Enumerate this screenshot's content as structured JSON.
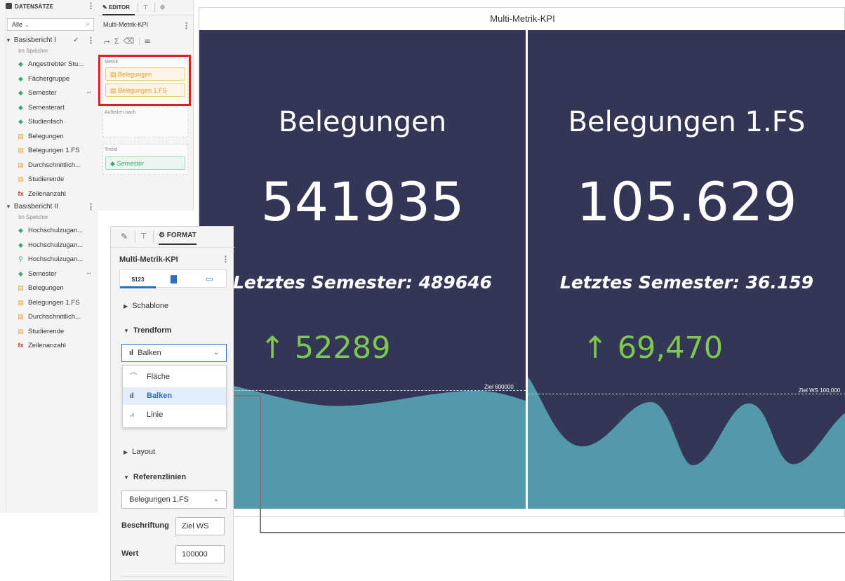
{
  "datasets": {
    "header": "DATENSÄTZE",
    "filter": "Alle",
    "groups": [
      {
        "name": "Basisbericht I",
        "storage": "Im Speicher",
        "items": [
          {
            "label": "Angestrebter Stu...",
            "kind": "dimension"
          },
          {
            "label": "Fächergruppe",
            "kind": "dimension"
          },
          {
            "label": "Semester",
            "kind": "dimension"
          },
          {
            "label": "Semesterart",
            "kind": "dimension"
          },
          {
            "label": "Studienfach",
            "kind": "dimension"
          },
          {
            "label": "Belegungen",
            "kind": "measure"
          },
          {
            "label": "Belegungen 1.FS",
            "kind": "measure"
          },
          {
            "label": "Durchschnittlich...",
            "kind": "measure"
          },
          {
            "label": "Studierende",
            "kind": "measure"
          },
          {
            "label": "Zeilenanzahl",
            "kind": "calc"
          }
        ]
      },
      {
        "name": "Basisbericht II",
        "storage": "Im Speicher",
        "items": [
          {
            "label": "Hochschulzugan...",
            "kind": "dimension"
          },
          {
            "label": "Hochschulzugan...",
            "kind": "dimension"
          },
          {
            "label": "Hochschulzugan...",
            "kind": "location"
          },
          {
            "label": "Semester",
            "kind": "dimension"
          },
          {
            "label": "Belegungen",
            "kind": "measure"
          },
          {
            "label": "Belegungen 1.FS",
            "kind": "measure"
          },
          {
            "label": "Durchschnittlich...",
            "kind": "measure"
          },
          {
            "label": "Studierende",
            "kind": "measure"
          },
          {
            "label": "Zeilenanzahl",
            "kind": "calc"
          }
        ]
      }
    ]
  },
  "editor": {
    "tab_label": "EDITOR",
    "title": "Multi-Metrik-KPI",
    "metric_label": "Metrik",
    "metrics": [
      "Belegungen",
      "Belegungen 1.FS"
    ],
    "split_label": "Aufteilen nach",
    "trend_label": "Trend",
    "trend_field": "Semester"
  },
  "visual": {
    "title": "Multi-Metrik-KPI",
    "tiles": [
      {
        "name": "Belegungen",
        "value": "541935",
        "last": "Letztes Semester: 489646",
        "trend": "↑ 52289",
        "ref_label": "Ziel 600000"
      },
      {
        "name": "Belegungen 1.FS",
        "value": "105.629",
        "last": "Letztes Semester: 36.159",
        "trend": "↑ 69,470",
        "ref_label": "Ziel WS 100,000"
      }
    ],
    "colors": {
      "tile_bg": "#333654",
      "wave": "#5199ab",
      "trend": "#7ec850"
    }
  },
  "format": {
    "tab_label": "FORMAT",
    "title": "Multi-Metrik-KPI",
    "icons": {
      "a": "$123",
      "b": "chart-icon",
      "c": "frame-icon"
    },
    "sections": {
      "schablone": "Schablone",
      "trendform": "Trendform",
      "layout": "Layout",
      "referenzlinien": "Referenzlinien"
    },
    "trend_select": "Balken",
    "trend_options": [
      "Fläche",
      "Balken",
      "Linie"
    ],
    "ref_select": "Belegungen 1.FS",
    "caption_label": "Beschriftung",
    "caption_value": "Ziel WS",
    "value_label": "Wert",
    "value_value": "100000"
  }
}
